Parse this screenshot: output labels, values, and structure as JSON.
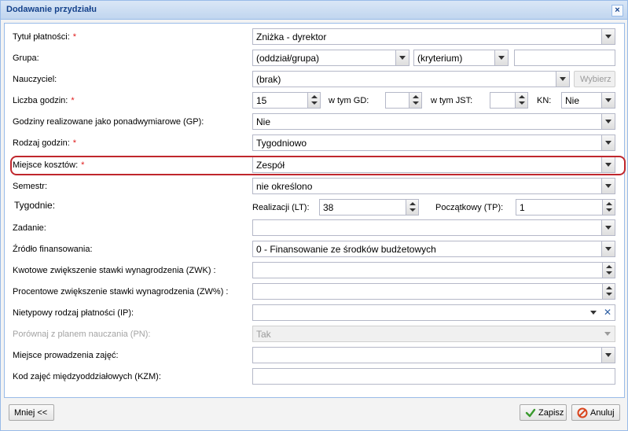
{
  "window": {
    "title": "Dodawanie przydziału",
    "close_icon": "×"
  },
  "fields": {
    "tytul": {
      "label": "Tytuł płatności:",
      "value": "Zniżka - dyrektor"
    },
    "grupa": {
      "label": "Grupa:",
      "value": "(oddział/grupa)",
      "kryterium": "(kryterium)",
      "extra": ""
    },
    "nauczyciel": {
      "label": "Nauczyciel:",
      "value": "(brak)",
      "button": "Wybierz"
    },
    "liczba": {
      "label": "Liczba godzin:",
      "value": "15",
      "gd_label": "w tym GD:",
      "gd_value": "",
      "jst_label": "w tym JST:",
      "jst_value": "",
      "kn_label": "KN:",
      "kn_value": "Nie"
    },
    "gp": {
      "label": "Godziny realizowane jako ponadwymiarowe (GP):",
      "value": "Nie"
    },
    "rodzaj": {
      "label": "Rodzaj godzin:",
      "value": "Tygodniowo"
    },
    "miejsce_kosztow": {
      "label": "Miejsce kosztów:",
      "value": "Zespół"
    },
    "semestr": {
      "label": "Semestr:",
      "value": "nie określono"
    },
    "tygodnie": {
      "label": "Tygodnie:",
      "lt_label": "Realizacji (LT):",
      "lt_value": "38",
      "tp_label": "Początkowy (TP):",
      "tp_value": "1"
    },
    "zadanie": {
      "label": "Zadanie:",
      "value": ""
    },
    "zrodlo": {
      "label": "Źródło finansowania:",
      "value": "0 - Finansowanie ze środków budżetowych"
    },
    "zwk": {
      "label": "Kwotowe zwiększenie stawki wynagrodzenia (ZWK) :",
      "value": ""
    },
    "zwp": {
      "label": "Procentowe zwiększenie stawki wynagrodzenia (ZW%) :",
      "value": ""
    },
    "ip": {
      "label": "Nietypowy rodzaj płatności (IP):",
      "value": ""
    },
    "pn": {
      "label": "Porównaj z planem nauczania (PN):",
      "value": "Tak"
    },
    "miejsce_prow": {
      "label": "Miejsce prowadzenia zajęć:",
      "value": ""
    },
    "kzm": {
      "label": "Kod zajęć międzyoddziałowych (KZM):",
      "value": ""
    }
  },
  "required_mark": "*",
  "footer": {
    "less_button": "Mniej <<",
    "save_button": "Zapisz",
    "cancel_button": "Anuluj"
  }
}
